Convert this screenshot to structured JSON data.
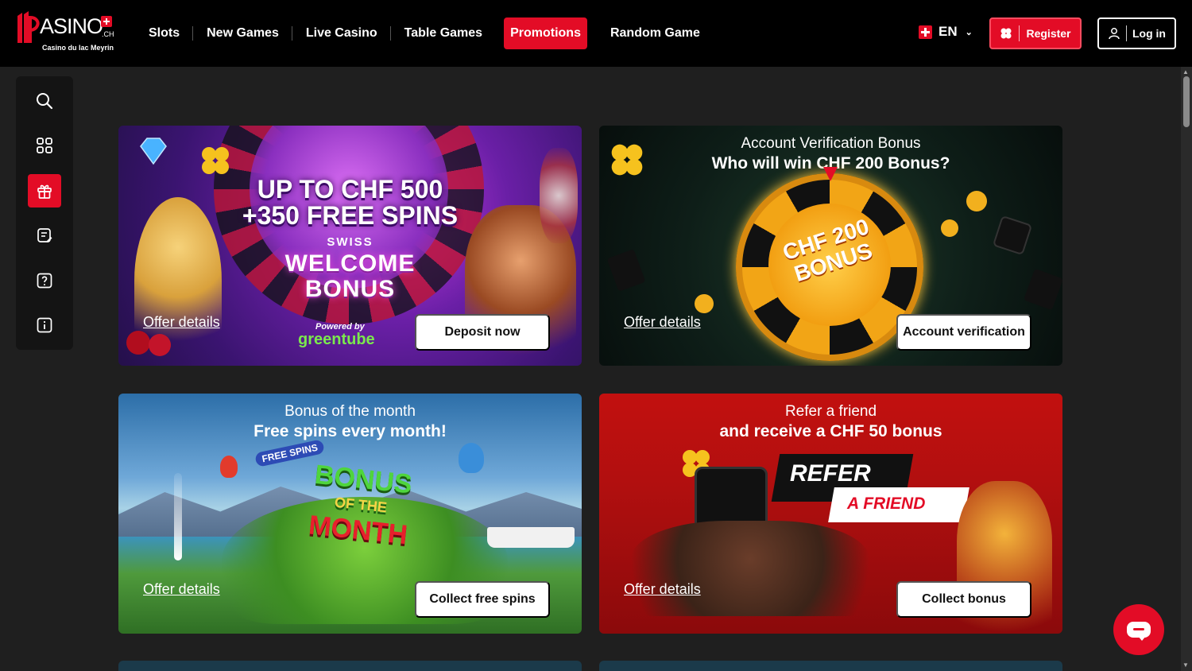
{
  "header": {
    "logo_text": "ASINO",
    "logo_ch": ".CH",
    "logo_subtitle": "Casino du lac Meyrin",
    "nav": [
      "Slots",
      "New Games",
      "Live Casino",
      "Table Games",
      "Promotions",
      "Random Game"
    ],
    "active_nav": "Promotions",
    "language": "EN",
    "register_label": "Register",
    "login_label": "Log in"
  },
  "sidebar": {
    "items": [
      "search-icon",
      "grid-icon",
      "gift-icon",
      "notes-icon",
      "help-icon",
      "info-icon"
    ],
    "active": "gift-icon"
  },
  "promos": [
    {
      "art_line1": "UP TO CHF 500",
      "art_line2": "+350 FREE SPINS",
      "art_swiss": "SWISS",
      "art_welcome": "WELCOME",
      "art_bonus": "BONUS",
      "art_powered": "Powered by",
      "art_brand": "greentube",
      "offer_label": "Offer details",
      "cta_label": "Deposit now"
    },
    {
      "title": "Account Verification Bonus",
      "subtitle": "Who will win CHF 200 Bonus?",
      "art_wheel_line1": "CHF 200",
      "art_wheel_line2": "BONUS",
      "offer_label": "Offer details",
      "cta_label": "Account verification"
    },
    {
      "title": "Bonus of the month",
      "subtitle": "Free spins every month!",
      "art_badge": "FREE SPINS",
      "art_bonus": "BONUS",
      "art_of": "OF THE",
      "art_month": "MONTH",
      "offer_label": "Offer details",
      "cta_label": "Collect free spins"
    },
    {
      "title": "Refer a friend",
      "subtitle": "and receive a CHF 50 bonus",
      "art_refer": "REFER",
      "art_friend": "A FRIEND",
      "offer_label": "Offer details",
      "cta_label": "Collect bonus"
    }
  ],
  "colors": {
    "accent": "#e30c26",
    "background": "#1f1f1f",
    "header": "#000000"
  }
}
